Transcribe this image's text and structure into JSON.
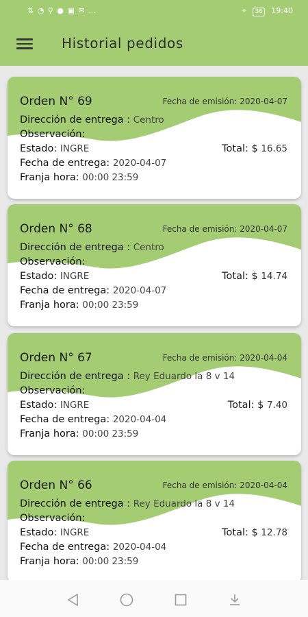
{
  "status_bar": {
    "left_icons": "⇅ ◔ ⚲  ● ▣ ✉ …",
    "location_icon": "⌖",
    "battery": "36",
    "time": "19:40"
  },
  "app_bar": {
    "title": "Historial pedidos",
    "menu_icon": "hamburger-menu-icon"
  },
  "labels": {
    "fecha_emision": "Fecha de emisión:",
    "direccion": "Dirección de entrega :",
    "observacion": "Observación:",
    "estado": "Estado:",
    "fecha_entrega": "Fecha de entrega:",
    "franja": "Franja hora:",
    "total": "Total: $"
  },
  "orders": [
    {
      "title": "Orden N° 69",
      "fecha_emision": "2020-04-07",
      "direccion": "Centro",
      "observacion": "",
      "estado": "INGRE",
      "total": "16.65",
      "fecha_entrega": "2020-04-07",
      "franja": "00:00 23:59"
    },
    {
      "title": "Orden N° 68",
      "fecha_emision": "2020-04-07",
      "direccion": "Centro",
      "observacion": "",
      "estado": "INGRE",
      "total": "14.74",
      "fecha_entrega": "2020-04-07",
      "franja": "00:00 23:59"
    },
    {
      "title": "Orden N° 67",
      "fecha_emision": "2020-04-04",
      "direccion": "Rey Eduardo la 8 v 14",
      "observacion": "",
      "estado": "INGRE",
      "total": "7.40",
      "fecha_entrega": "2020-04-04",
      "franja": "00:00 23:59"
    },
    {
      "title": "Orden N° 66",
      "fecha_emision": "2020-04-04",
      "direccion": "Rey Eduardo la 8 v 14",
      "observacion": "",
      "estado": "INGRE",
      "total": "12.78",
      "fecha_entrega": "2020-04-04",
      "franja": "00:00 23:59"
    }
  ],
  "colors": {
    "accent": "#a4cc73",
    "card_background": "#ffffff",
    "page_background": "#e9e9e9"
  },
  "nav_bar": {
    "icons": [
      "back-triangle-icon",
      "home-circle-icon",
      "recents-square-icon",
      "notification-pull-down-icon"
    ]
  }
}
